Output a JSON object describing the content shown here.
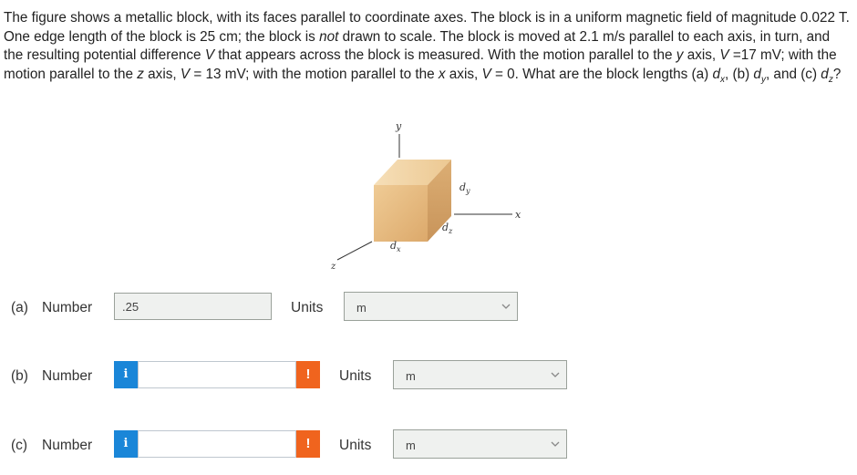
{
  "problem": {
    "s1": "The figure shows a metallic block, with its faces parallel to coordinate axes. The block is in a uniform magnetic field of magnitude 0.022 T. One edge length of the block is 25 cm; the block is ",
    "s1_not": "not",
    "s2": " drawn to scale. The block is moved at 2.1 m/s parallel to each axis, in turn, and the resulting potential difference ",
    "V1": "V",
    "s3": " that appears across the block is measured. With the motion parallel to the ",
    "y1": "y",
    "s4": " axis, ",
    "V2": "V",
    "s5": " =17 mV; with the motion parallel to the ",
    "z1": "z",
    "s6": " axis, ",
    "V3": "V",
    "s7": " = 13 mV; with the motion parallel to the ",
    "x1": "x",
    "s8": " axis, ",
    "V4": "V",
    "s9": " = 0. What are the block lengths (a) ",
    "dx_d": "d",
    "dx_sub": "x",
    "s10": ", (b) ",
    "dy_d": "d",
    "dy_sub": "y",
    "s11": ", and (c) ",
    "dz_d": "d",
    "dz_sub": "z",
    "s12": "?"
  },
  "figure": {
    "axis_y": "y",
    "axis_x": "x",
    "axis_z": "z",
    "label_dx": "d",
    "label_dx_sub": "x",
    "label_dy": "d",
    "label_dy_sub": "y",
    "label_dz": "d",
    "label_dz_sub": "z",
    "colors": {
      "front": "#e6bc86",
      "top": "#f2d6a8",
      "side": "#d29f63",
      "axis": "#333333"
    }
  },
  "answers": {
    "a": {
      "part": "(a)",
      "number_label": "Number",
      "value": ".25",
      "units_label": "Units",
      "unit": "m"
    },
    "b": {
      "part": "(b)",
      "number_label": "Number",
      "info_icon": "i",
      "value": "",
      "warn_icon": "!",
      "units_label": "Units",
      "unit": "m"
    },
    "c": {
      "part": "(c)",
      "number_label": "Number",
      "info_icon": "i",
      "value": "",
      "warn_icon": "!",
      "units_label": "Units",
      "unit": "m"
    }
  },
  "colors": {
    "info": "#1a86d8",
    "warning": "#f0641e",
    "field_bg": "#eff1ef"
  }
}
